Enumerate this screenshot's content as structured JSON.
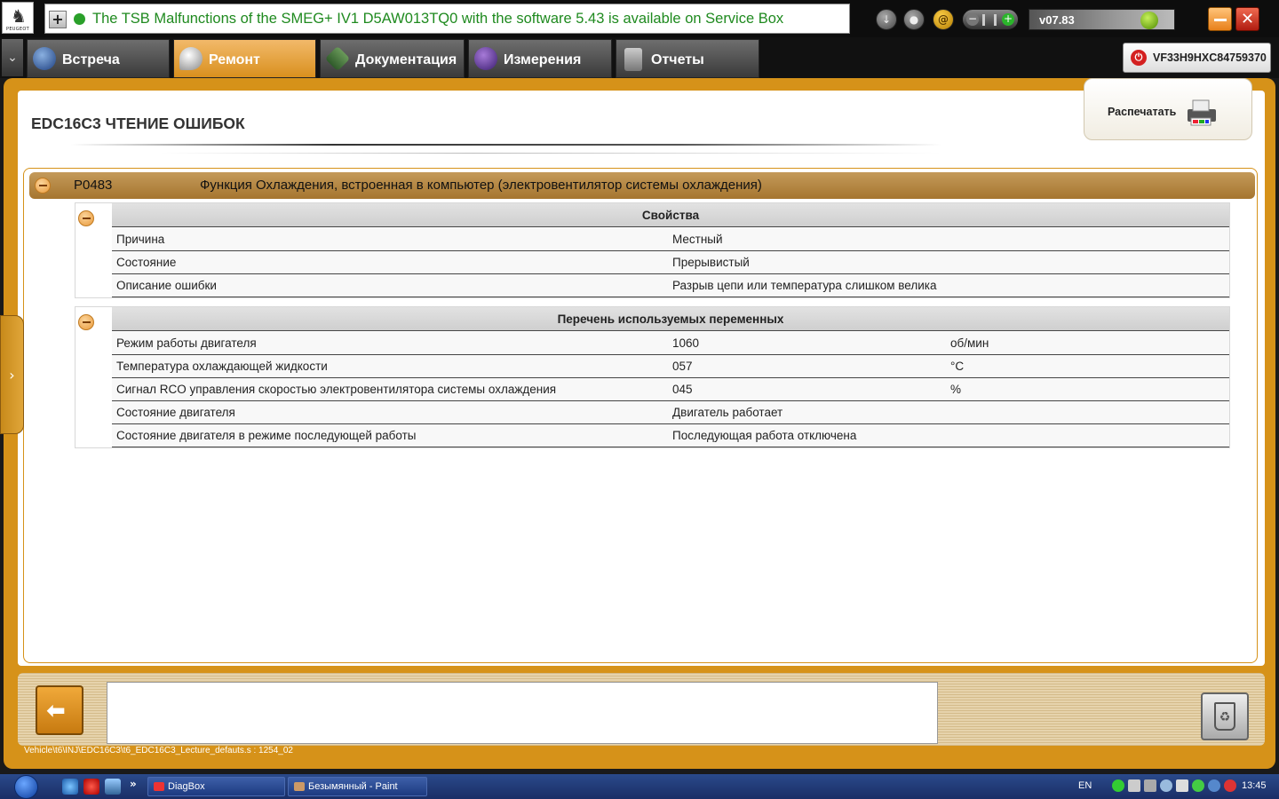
{
  "window": {
    "logo_brand": "PEUGEOT",
    "ticker_message": "The TSB Malfunctions of the SMEG+ IV1 D5AW013TQ0 with the software 5.43 is available on Service Box",
    "version": "v07.83"
  },
  "nav": {
    "tabs": [
      {
        "label": "Встреча",
        "active": false
      },
      {
        "label": "Ремонт",
        "active": true
      },
      {
        "label": "Документация",
        "active": false
      },
      {
        "label": "Измерения",
        "active": false
      },
      {
        "label": "Отчеты",
        "active": false
      }
    ],
    "vin": "VF33H9HXC84759370"
  },
  "page": {
    "title": "EDC16C3  ЧТЕНИЕ ОШИБОК",
    "print_label": "Распечатать"
  },
  "fault": {
    "code": "P0483",
    "description": "Функция Охлаждения, встроенная в компьютер (электровентилятор системы охлаждения)"
  },
  "properties": {
    "title": "Свойства",
    "rows": [
      {
        "name": "Причина",
        "value": "Местный"
      },
      {
        "name": "Состояние",
        "value": "Прерывистый"
      },
      {
        "name": "Описание ошибки",
        "value": "Разрыв цепи или температура слишком велика"
      }
    ]
  },
  "variables": {
    "title": "Перечень используемых переменных",
    "rows": [
      {
        "name": "Режим работы двигателя",
        "value": "1060",
        "unit": "об/мин"
      },
      {
        "name": "Температура охлаждающей жидкости",
        "value": "057",
        "unit": "°C"
      },
      {
        "name": "Сигнал RCO управления скоростью электровентилятора системы охлаждения",
        "value": "045",
        "unit": "%"
      },
      {
        "name": "Состояние двигателя",
        "value": "Двигатель работает",
        "unit": ""
      },
      {
        "name": "Состояние двигателя в режиме последующей работы",
        "value": "Последующая работа отключена",
        "unit": ""
      }
    ]
  },
  "status_path": "Vehicle\\t6\\INJ\\EDC16C3\\t6_EDC16C3_Lecture_defauts.s : 1254_02",
  "taskbar": {
    "tasks": [
      "DiagBox",
      "Безымянный - Paint"
    ],
    "language": "EN",
    "clock": "13:45"
  },
  "colors": {
    "accent_orange": "#d69219",
    "ticker_green": "#1f8a1f",
    "fault_header": "#b07e36"
  }
}
